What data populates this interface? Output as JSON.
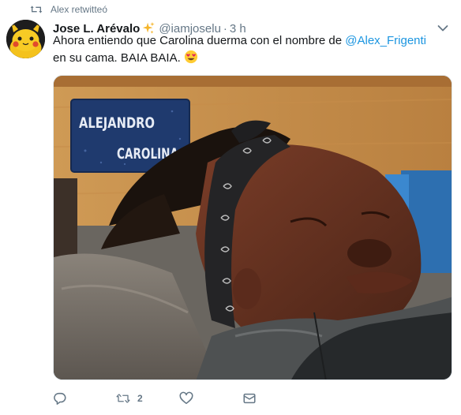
{
  "retweet": {
    "label": "Alex retwitteó",
    "icon": "retweet-icon"
  },
  "tweet": {
    "author": {
      "display_name": "Jose L. Arévalo",
      "name_emoji": "sparkles-icon",
      "handle": "@iamjoselu",
      "separator": "·",
      "time": "3 h"
    },
    "text": {
      "part1": "Ahora entiendo que Carolina duerma con el nombre de ",
      "mention": "@Alex_Frigenti",
      "part2": " en su cama. BAIA BAIA. ",
      "emoji": "heart-eyes-icon"
    },
    "media": {
      "sign_line1": "ALEJANDRO",
      "sign_line2": "CAROLINA"
    },
    "actions": {
      "reply": {
        "icon": "reply-icon",
        "count": ""
      },
      "retweet": {
        "icon": "retweet-icon",
        "count": "2"
      },
      "like": {
        "icon": "heart-icon",
        "count": ""
      },
      "dm": {
        "icon": "envelope-icon",
        "count": ""
      }
    }
  },
  "colors": {
    "link": "#1b95e0",
    "secondary": "#657786",
    "text": "#14171a",
    "retweet_green": "#657786"
  }
}
